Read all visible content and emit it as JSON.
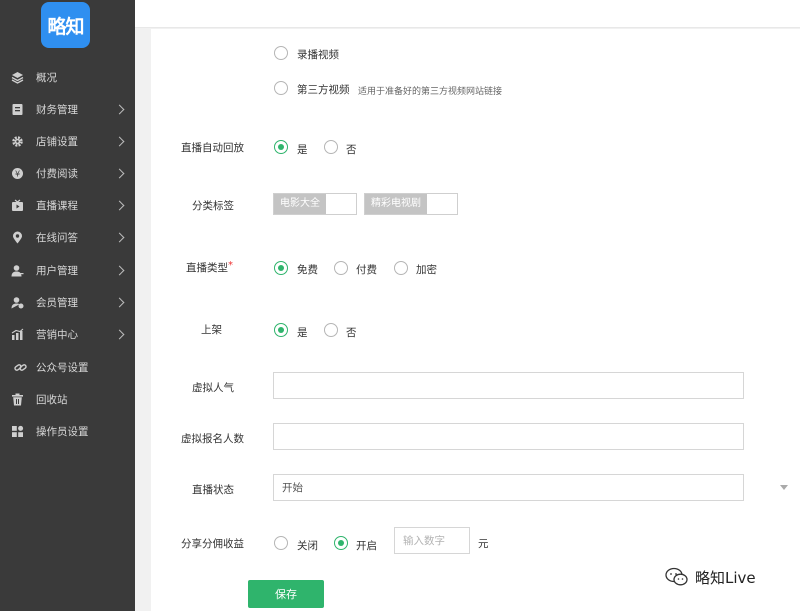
{
  "logo": {
    "text": "略知"
  },
  "sidebar": {
    "items": [
      {
        "label": "概况",
        "icon": "layers-icon",
        "arrow": false
      },
      {
        "label": "财务管理",
        "icon": "finance-icon",
        "arrow": true
      },
      {
        "label": "店铺设置",
        "icon": "gear-icon",
        "arrow": true
      },
      {
        "label": "付费阅读",
        "icon": "paid-reading-icon",
        "arrow": true
      },
      {
        "label": "直播课程",
        "icon": "live-course-icon",
        "arrow": true
      },
      {
        "label": "在线问答",
        "icon": "location-pin-icon",
        "arrow": true
      },
      {
        "label": "用户管理",
        "icon": "user-icon",
        "arrow": true
      },
      {
        "label": "会员管理",
        "icon": "member-icon",
        "arrow": true
      },
      {
        "label": "营销中心",
        "icon": "chart-icon",
        "arrow": true
      },
      {
        "label": "公众号设置",
        "icon": "link-icon",
        "arrow": false
      },
      {
        "label": "回收站",
        "icon": "trash-icon",
        "arrow": false
      },
      {
        "label": "操作员设置",
        "icon": "grid-icon",
        "arrow": false
      }
    ]
  },
  "form": {
    "video_source": {
      "record_label": "录播视频",
      "third_party_label": "第三方视频",
      "third_party_hint": "适用于准备好的第三方视频网站链接"
    },
    "auto_replay": {
      "label": "直播自动回放",
      "yes": "是",
      "no": "否",
      "selected": "是"
    },
    "category_tags": {
      "label": "分类标签",
      "tags": [
        "电影大全",
        "精彩电视剧"
      ]
    },
    "live_type": {
      "label": "直播类型",
      "required_mark": "*",
      "options": [
        "免费",
        "付费",
        "加密"
      ],
      "selected": "免费"
    },
    "on_shelf": {
      "label": "上架",
      "yes": "是",
      "no": "否",
      "selected": "是"
    },
    "virtual_popularity": {
      "label": "虚拟人气",
      "value": ""
    },
    "virtual_signups": {
      "label": "虚拟报名人数",
      "value": ""
    },
    "live_status": {
      "label": "直播状态",
      "value": "开始"
    },
    "share_commission": {
      "label": "分享分佣收益",
      "off": "关闭",
      "on": "开启",
      "selected": "开启",
      "placeholder": "输入数字",
      "unit": "元"
    },
    "save_label": "保存"
  },
  "watermark": {
    "text": "略知Live",
    "icon": "wechat-icon"
  }
}
